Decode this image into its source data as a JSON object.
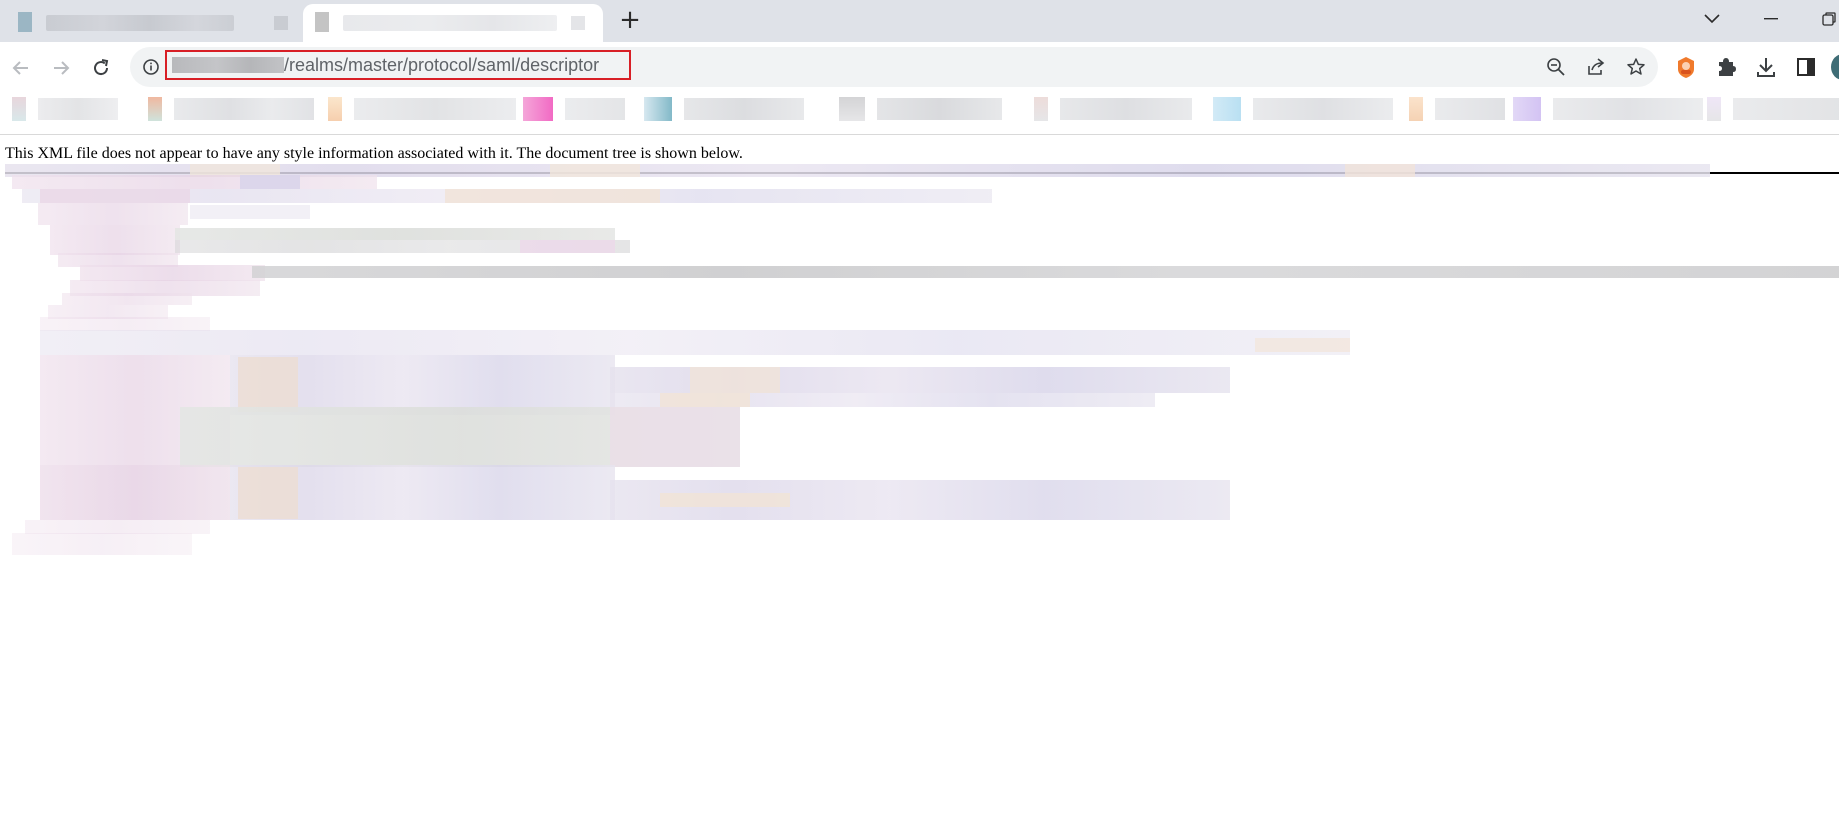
{
  "browser": {
    "tabs": [
      {
        "state": "inactive",
        "title": ""
      },
      {
        "state": "active",
        "title": ""
      }
    ],
    "new_tab_icon": "plus-icon",
    "window_controls": [
      "tab-search-chevron-icon",
      "minimize-icon",
      "restore-icon"
    ]
  },
  "toolbar": {
    "nav_icons": [
      "back-arrow-icon",
      "forward-arrow-icon",
      "reload-icon"
    ],
    "address": {
      "host": "",
      "path": "/realms/master/protocol/saml/descriptor",
      "highlight_color": "#d81f26"
    },
    "omnibox_icons": [
      "site-info-icon",
      "zoom-icon",
      "share-icon",
      "bookmark-star-icon"
    ],
    "extension_icons": [
      "extension-badge-icon",
      "puzzle-extensions-icon",
      "download-icon",
      "side-panel-icon",
      "profile-avatar"
    ]
  },
  "bookmarks_bar": {
    "items_count_visible": 10
  },
  "page": {
    "notice": "This XML file does not appear to have any style information associated with it. The document tree is shown below.",
    "xml_content": "",
    "xml_content_obscured": true
  },
  "colors": {
    "tabstrip_bg": "#dfe2e8",
    "omnibox_bg": "#f1f3f4",
    "url_text": "#5f6368",
    "url_highlight": "#d81f26",
    "page_bg": "#ffffff"
  }
}
